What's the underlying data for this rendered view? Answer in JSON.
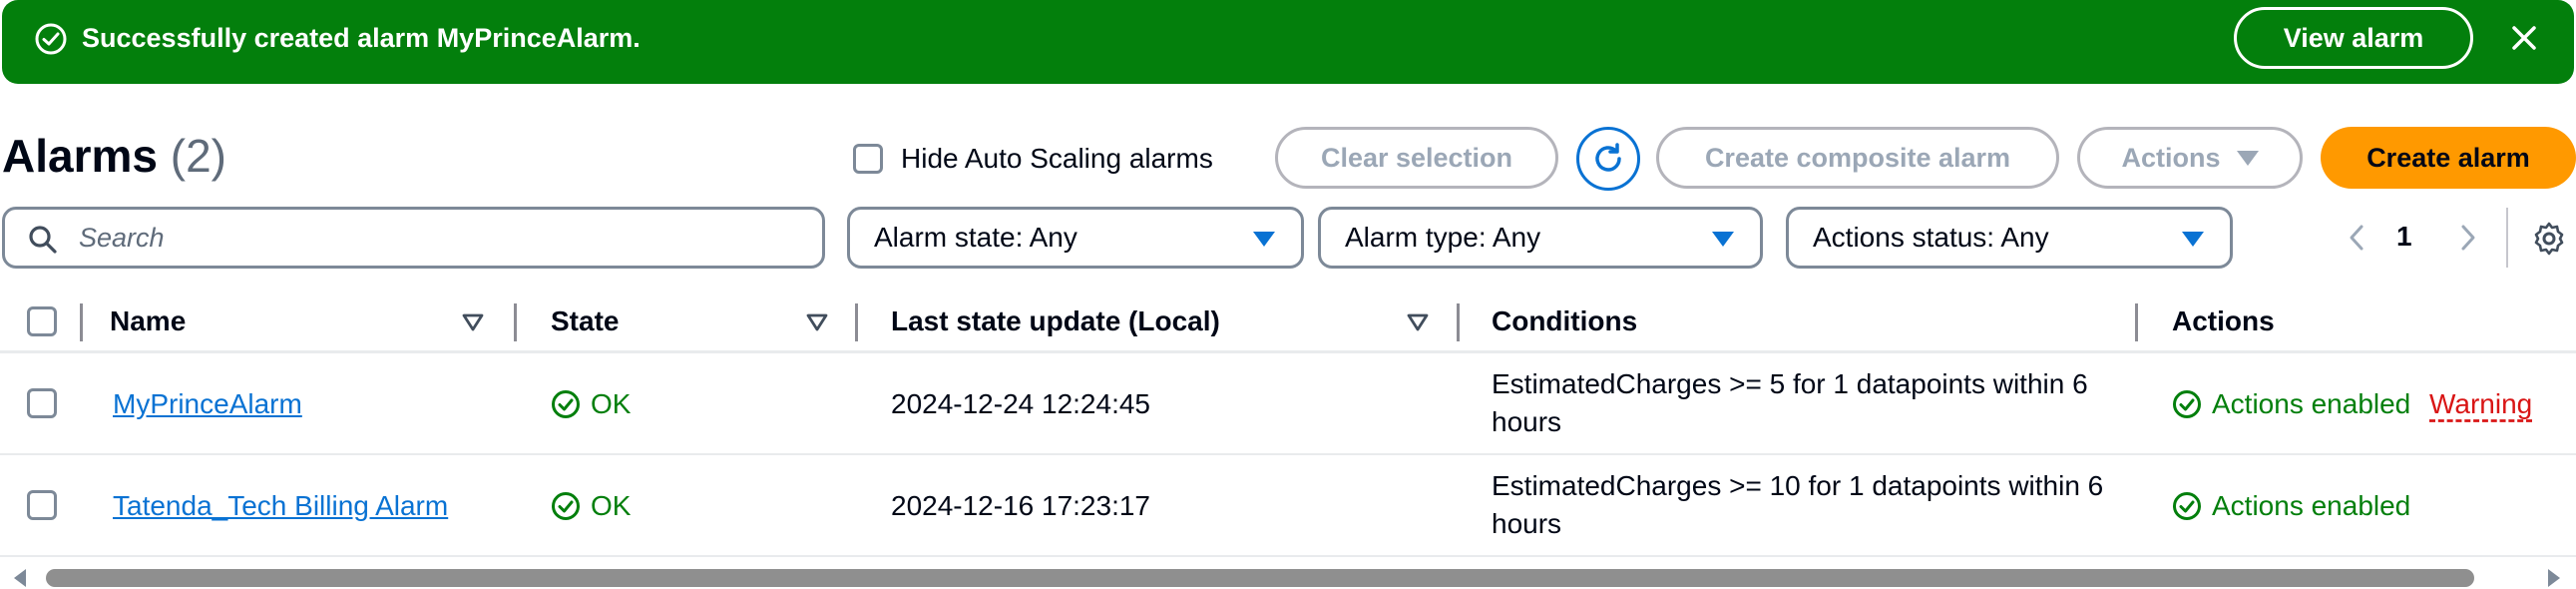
{
  "flash": {
    "message": "Successfully created alarm MyPrinceAlarm.",
    "view_label": "View alarm",
    "color": "#037f0c"
  },
  "header": {
    "title": "Alarms",
    "count": "(2)",
    "hide_autoscaling_label": "Hide Auto Scaling alarms",
    "clear_selection_label": "Clear selection",
    "create_composite_label": "Create composite alarm",
    "actions_label": "Actions",
    "create_alarm_label": "Create alarm",
    "create_alarm_color": "#ff9900"
  },
  "filters": {
    "search_placeholder": "Search",
    "alarm_state": "Alarm state: Any",
    "alarm_type": "Alarm type: Any",
    "actions_status": "Actions status: Any"
  },
  "pagination": {
    "current_page": "1"
  },
  "table": {
    "columns": [
      "Name",
      "State",
      "Last state update (Local)",
      "Conditions",
      "Actions"
    ],
    "rows": [
      {
        "name": "MyPrinceAlarm",
        "state": "OK",
        "last_update": "2024-12-24 12:24:45",
        "conditions": "EstimatedCharges >= 5 for 1 datapoints within 6 hours",
        "actions": "Actions enabled",
        "warning": "Warning"
      },
      {
        "name": "Tatenda_Tech Billing Alarm",
        "state": "OK",
        "last_update": "2024-12-16 17:23:17",
        "conditions": "EstimatedCharges >= 10 for 1 datapoints within 6 hours",
        "actions": "Actions enabled",
        "warning": ""
      }
    ]
  }
}
